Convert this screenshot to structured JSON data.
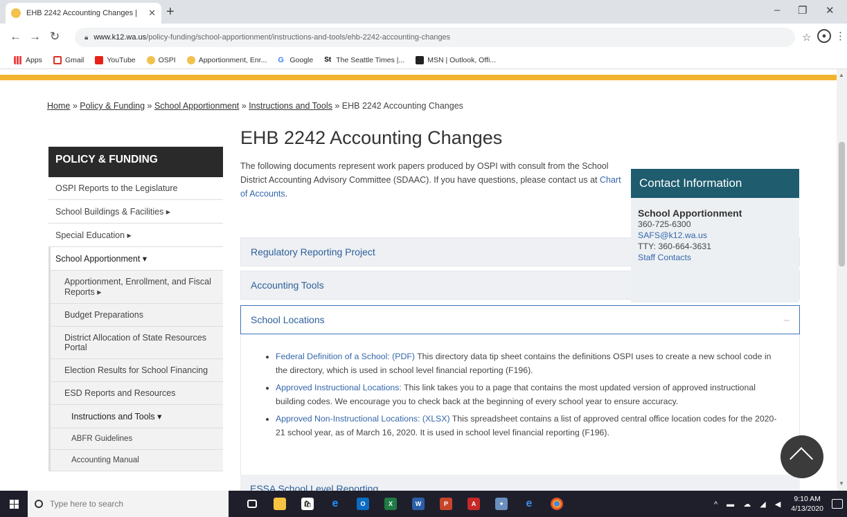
{
  "browser": {
    "tab_title": "EHB 2242 Accounting Changes |",
    "url_host": "www.k12.wa.us",
    "url_path": "/policy-funding/school-apportionment/instructions-and-tools/ehb-2242-accounting-changes",
    "bookmarks": [
      "Apps",
      "Gmail",
      "YouTube",
      "OSPI",
      "Apportionment, Enr...",
      "Google",
      "The Seattle Times |...",
      "MSN | Outlook, Offi..."
    ]
  },
  "breadcrumb": {
    "items": [
      "Home",
      "Policy & Funding",
      "School Apportionment",
      "Instructions and Tools"
    ],
    "current": "EHB 2242 Accounting Changes",
    "sep": " » "
  },
  "page": {
    "title": "EHB 2242 Accounting Changes",
    "intro": "The following documents represent work papers produced by OSPI with consult from the School District Accounting Advisory Committee (SDAAC). If you have questions, please contact us at ",
    "intro_link": "Chart of Accounts",
    "intro_end": "."
  },
  "sidebar": {
    "heading": "POLICY & FUNDING",
    "items": [
      "OSPI Reports to the Legislature",
      "School Buildings & Facilities ▸",
      "Special Education ▸",
      "School Apportionment ▾",
      "Apportionment, Enrollment, and Fiscal Reports ▸",
      "Budget Preparations",
      "District Allocation of State Resources Portal",
      "Election Results for School Financing",
      "ESD Reports and Resources",
      "Instructions and Tools ▾",
      "ABFR Guidelines",
      "Accounting Manual"
    ]
  },
  "accordions": [
    {
      "label": "Regulatory Reporting Project",
      "icon": "+"
    },
    {
      "label": "Accounting Tools",
      "icon": "+"
    },
    {
      "label": "School Locations",
      "icon": "–"
    },
    {
      "label": "ESSA School Level Reporting",
      "icon": "+"
    }
  ],
  "school_locations": [
    {
      "link": "Federal Definition of a School: (PDF)",
      "text": " This directory data tip sheet contains the definitions OSPI uses to create a new school code in the directory, which is used in school level financial reporting (F196)."
    },
    {
      "link": "Approved Instructional Locations:",
      "text": " This link takes you to a page that contains the most updated version of approved instructional building codes. We encourage you to check back at the beginning of every school year to ensure accuracy."
    },
    {
      "link": "Approved Non-Instructional Locations: (XLSX)",
      "text": " This spreadsheet contains a list of approved central office location codes for the 2020-21 school year, as of March 16, 2020. It is used in school level financial reporting (F196)."
    }
  ],
  "contact": {
    "heading": "Contact Information",
    "org": "School Apportionment",
    "phone": "360-725-6300",
    "email": "SAFS@k12.wa.us",
    "tty": "TTY: 360-664-3631",
    "staff": "Staff Contacts"
  },
  "taskbar": {
    "search_placeholder": "Type here to search",
    "time": "9:10 AM",
    "date": "4/13/2020"
  },
  "colors": {
    "gold": "#f2b430",
    "teal": "#1e5c6e",
    "link": "#3366aa"
  }
}
